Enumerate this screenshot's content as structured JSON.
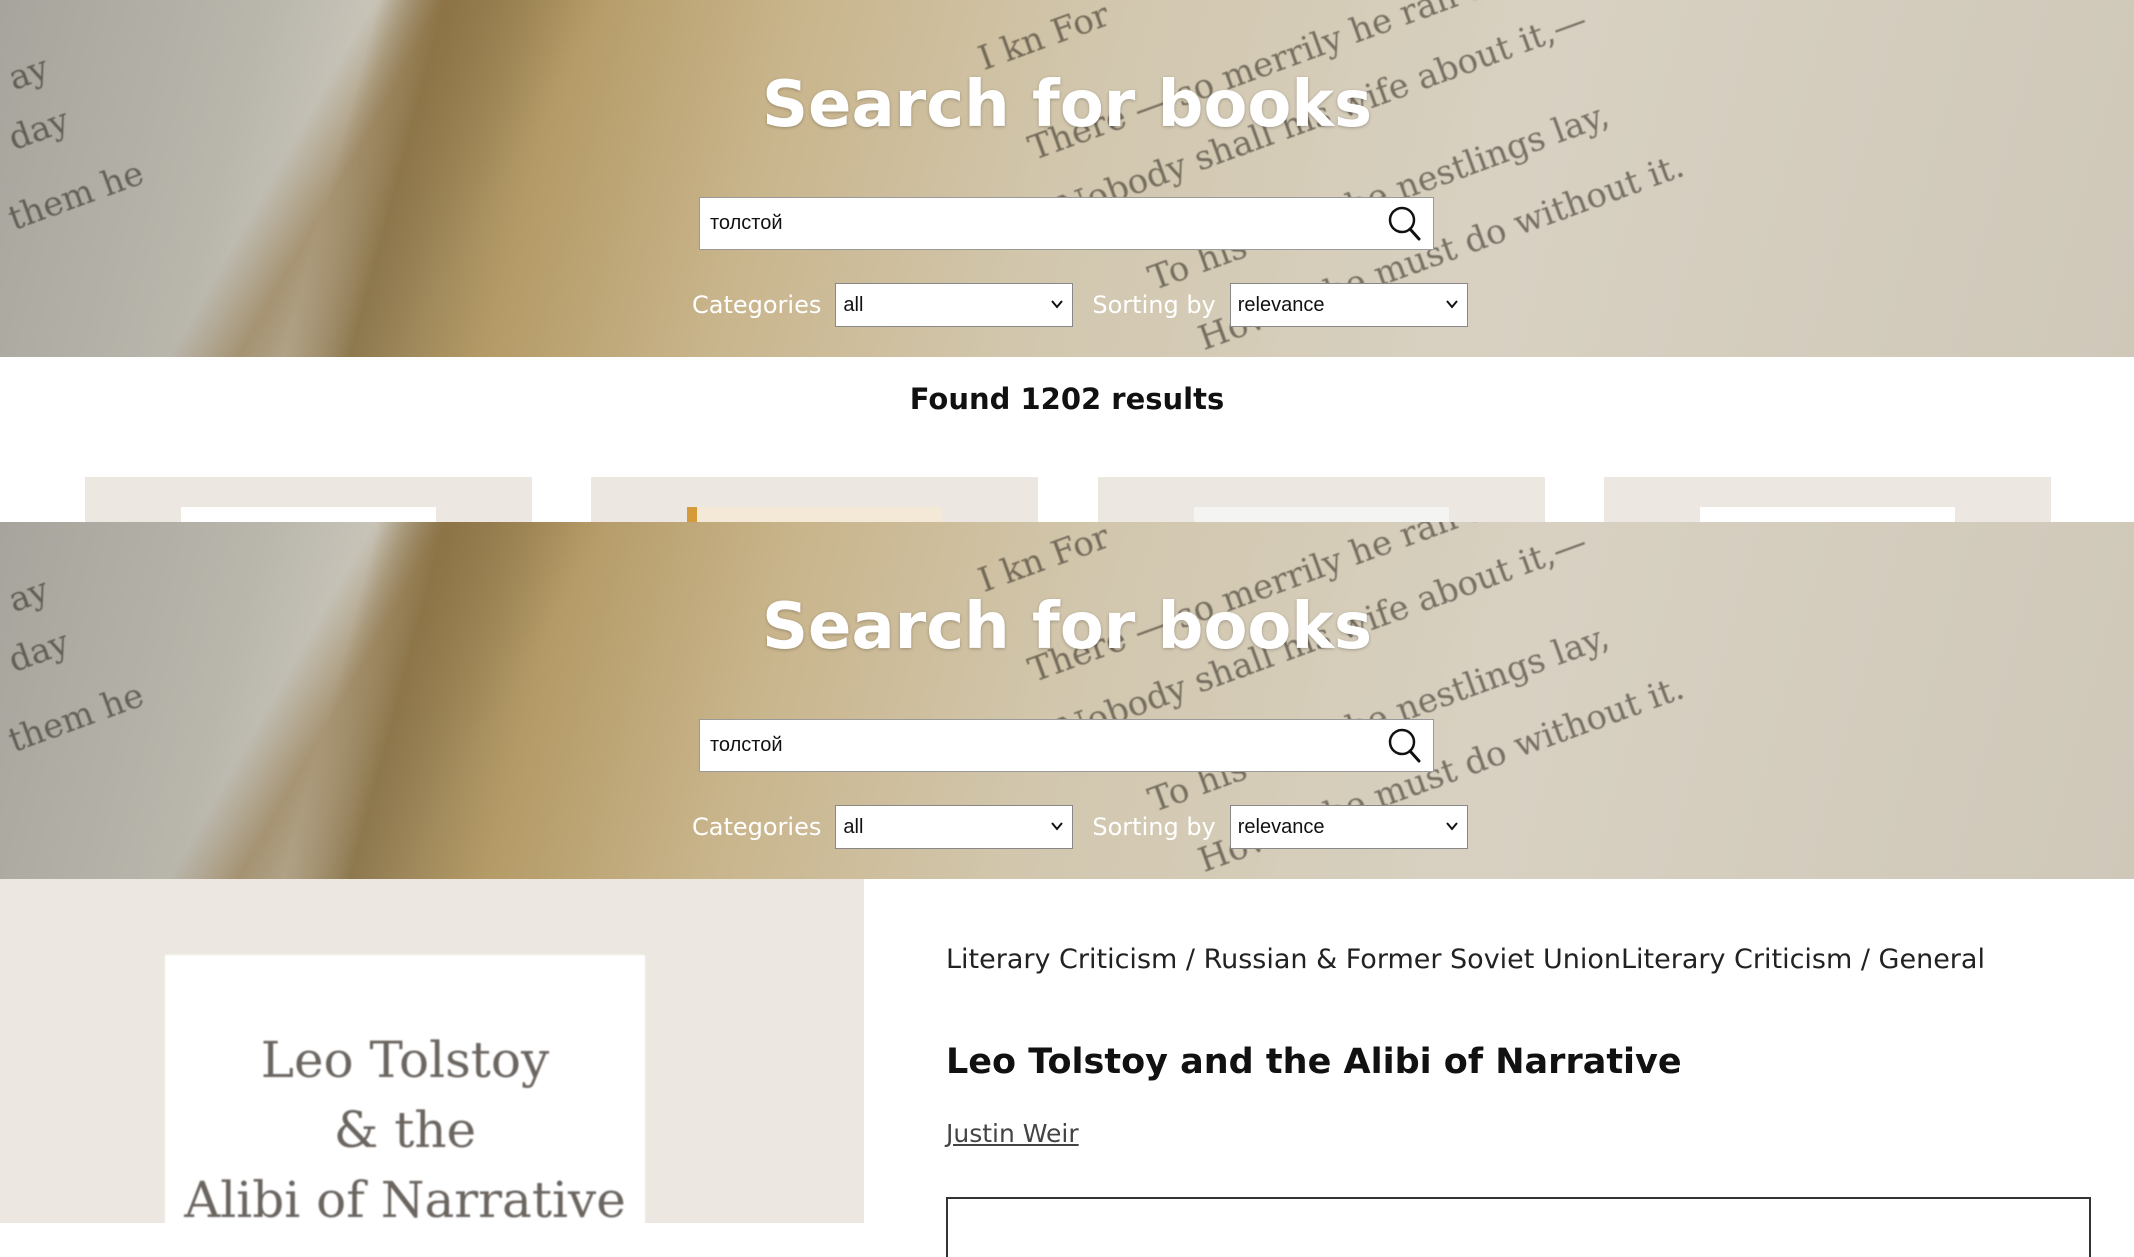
{
  "header": {
    "title": "Search for books",
    "search": {
      "value": "толстой",
      "placeholder": ""
    },
    "filters": {
      "categories_label": "Categories",
      "categories_value": "all",
      "sorting_label": "Sorting by",
      "sorting_value": "relevance"
    }
  },
  "results": {
    "found_text": "Found 1202 results"
  },
  "detail": {
    "categories": "Literary Criticism / Russian & Former Soviet UnionLiterary Criticism / General",
    "title": "Leo Tolstoy and the Alibi of Narrative",
    "author": "Justin Weir",
    "cover_lines": [
      "Leo Tolstoy",
      "& the",
      "Alibi of Narrative"
    ]
  },
  "colors": {
    "panel_bg": "#ece8e1",
    "hero_text": "#ffffff"
  },
  "icons": {
    "search": "search-icon",
    "dropdown": "chevron-down-icon"
  }
}
